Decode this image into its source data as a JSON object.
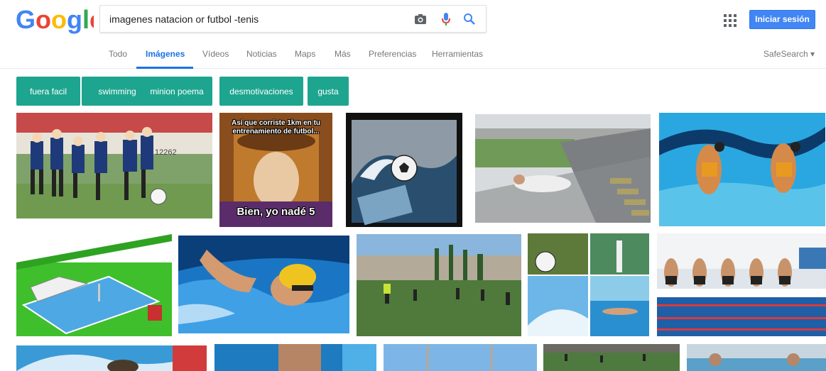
{
  "search": {
    "query": "imagenes natacion or futbol -tenis"
  },
  "header": {
    "signin_label": "Iniciar sesión"
  },
  "nav": {
    "tabs": [
      "Todo",
      "Imágenes",
      "Vídeos",
      "Noticias",
      "Maps",
      "Más",
      "Preferencias",
      "Herramientas"
    ],
    "active": "Imágenes",
    "safesearch": "SafeSearch ▾"
  },
  "chips": [
    "fuera facil",
    "swimming",
    "minion poema",
    "desmotivaciones",
    "gusta"
  ],
  "images": {
    "meme_top": "Así que corriste 1km en tu entrenamiento de futbol...",
    "meme_bottom": "Bien, yo nadé 5",
    "kids_sign": "12262"
  },
  "colors": {
    "chip": "#1ea58f",
    "accent": "#1a73e8",
    "signin": "#4285f4"
  },
  "icons": [
    "camera-icon",
    "microphone-icon",
    "search-icon",
    "apps-grid-icon"
  ]
}
